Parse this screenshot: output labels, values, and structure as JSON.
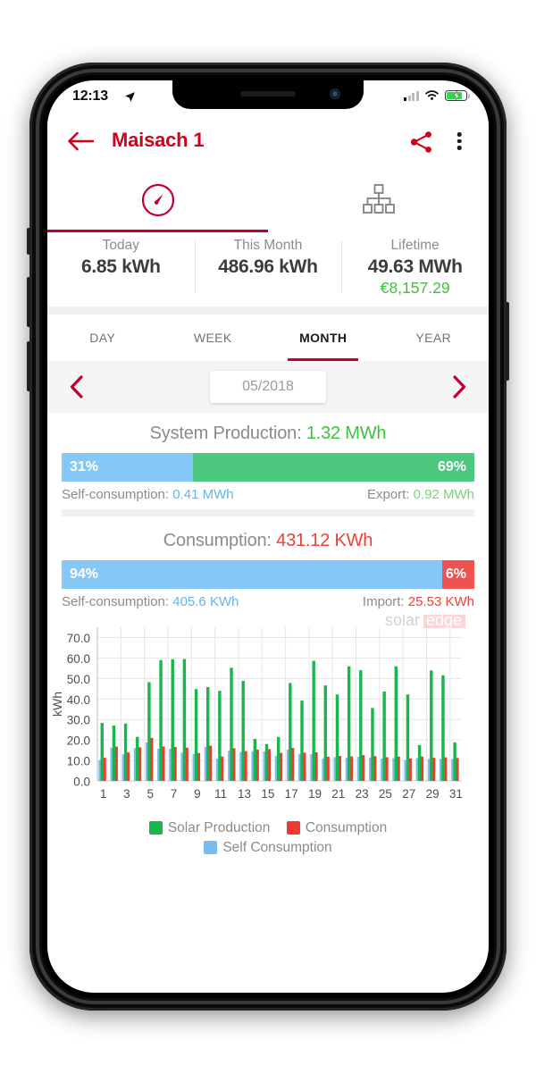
{
  "status_bar": {
    "time": "12:13",
    "location_icon": "location-arrow-icon",
    "signal_icon": "cellular-signal-icon",
    "wifi_icon": "wifi-icon",
    "battery_icon": "battery-charging-icon"
  },
  "header": {
    "back_icon": "arrow-left-icon",
    "title": "Maisach 1",
    "share_icon": "share-icon",
    "menu_icon": "overflow-menu-icon"
  },
  "icon_tabs": [
    {
      "name": "dashboard-tab",
      "icon": "gauge-icon",
      "active": true
    },
    {
      "name": "layout-tab",
      "icon": "site-layout-icon",
      "active": false
    }
  ],
  "summary": [
    {
      "label": "Today",
      "value": "6.85 kWh",
      "money": ""
    },
    {
      "label": "This Month",
      "value": "486.96 kWh",
      "money": ""
    },
    {
      "label": "Lifetime",
      "value": "49.63 MWh",
      "money": "€8,157.29"
    }
  ],
  "period_tabs": [
    {
      "label": "DAY",
      "active": false
    },
    {
      "label": "WEEK",
      "active": false
    },
    {
      "label": "MONTH",
      "active": true
    },
    {
      "label": "YEAR",
      "active": false
    }
  ],
  "date_nav": {
    "prev_icon": "chevron-left-icon",
    "value": "05/2018",
    "next_icon": "chevron-right-icon"
  },
  "production": {
    "title_label": "System Production:",
    "title_value": "1.32 MWh",
    "left_pct": "31%",
    "right_pct": "69%",
    "left_ratio": 31,
    "right_ratio": 69,
    "foot_left_label": "Self-consumption:",
    "foot_left_value": "0.41 MWh",
    "foot_right_label": "Export:",
    "foot_right_value": "0.92 MWh"
  },
  "consumption": {
    "title_label": "Consumption:",
    "title_value": "431.12 KWh",
    "left_pct": "94%",
    "right_pct": "6%",
    "left_ratio": 94,
    "right_ratio": 6,
    "foot_left_label": "Self-consumption:",
    "foot_left_value": "405.6 KWh",
    "foot_right_label": "Import:",
    "foot_right_value": "25.53 KWh"
  },
  "watermark": {
    "part1": "solar",
    "part2": "edge"
  },
  "colors": {
    "brand_red": "#c2002f",
    "header_red": "#d0021b",
    "money_green": "#3dc13d",
    "production_green": "#4ec77f",
    "production_value_green": "#3dc13d",
    "consumption_red": "#ef5350",
    "consumption_value_red": "#ef4036",
    "self_blue": "#85c8f7",
    "self_text_blue": "#62b4ec",
    "export_green": "#7dd07d",
    "chart_green": "#17b74e",
    "chart_red": "#ee3b2f",
    "chart_blue": "#79bdf0",
    "grid": "#e6e6e6",
    "axis_text": "#4d4d4d"
  },
  "chart_data": {
    "type": "bar",
    "title": "",
    "xlabel": "",
    "ylabel": "kWh",
    "ylim": [
      0,
      75
    ],
    "yticks": [
      "0.0",
      "10.0",
      "20.0",
      "30.0",
      "40.0",
      "50.0",
      "60.0",
      "70.0"
    ],
    "ytick_values": [
      0,
      10,
      20,
      30,
      40,
      50,
      60,
      70
    ],
    "grid": true,
    "legend_position": "bottom",
    "categories": [
      1,
      2,
      3,
      4,
      5,
      6,
      7,
      8,
      9,
      10,
      11,
      12,
      13,
      14,
      15,
      16,
      17,
      18,
      19,
      20,
      21,
      22,
      23,
      24,
      25,
      26,
      27,
      28,
      29,
      30,
      31
    ],
    "xtick_labels": [
      "1",
      "3",
      "5",
      "7",
      "9",
      "11",
      "13",
      "15",
      "17",
      "19",
      "21",
      "23",
      "25",
      "27",
      "29",
      "31"
    ],
    "series": [
      {
        "name": "Solar Production",
        "color": "#17b74e",
        "values": [
          28.3,
          27.0,
          28.0,
          21.5,
          48.2,
          59.0,
          59.4,
          59.5,
          44.8,
          45.8,
          44.0,
          55.2,
          48.8,
          20.5,
          18.0,
          21.5,
          47.8,
          39.2,
          58.6,
          46.6,
          42.2,
          55.9,
          54.0,
          35.6,
          43.6,
          55.9,
          42.2,
          17.5,
          53.9,
          51.6,
          18.8
        ]
      },
      {
        "name": "Consumption",
        "color": "#ee3b2f",
        "values": [
          11.3,
          16.8,
          13.9,
          16.4,
          21.0,
          16.8,
          16.6,
          16.2,
          13.6,
          17.2,
          11.9,
          16.0,
          14.6,
          15.3,
          15.5,
          13.7,
          16.1,
          13.8,
          14.0,
          11.8,
          12.2,
          12.0,
          12.6,
          12.1,
          11.6,
          11.9,
          11.0,
          11.9,
          11.3,
          11.5,
          11.2
        ]
      },
      {
        "name": "Self Consumption",
        "color": "#79bdf0",
        "values": [
          10.2,
          16.2,
          13.0,
          16.0,
          18.8,
          15.7,
          15.7,
          13.8,
          13.2,
          16.6,
          10.9,
          14.7,
          14.1,
          14.5,
          14.4,
          12.3,
          15.3,
          13.2,
          13.0,
          11.0,
          11.6,
          11.4,
          11.8,
          11.4,
          10.9,
          11.1,
          10.2,
          11.2,
          10.8,
          10.8,
          10.6
        ]
      }
    ]
  }
}
